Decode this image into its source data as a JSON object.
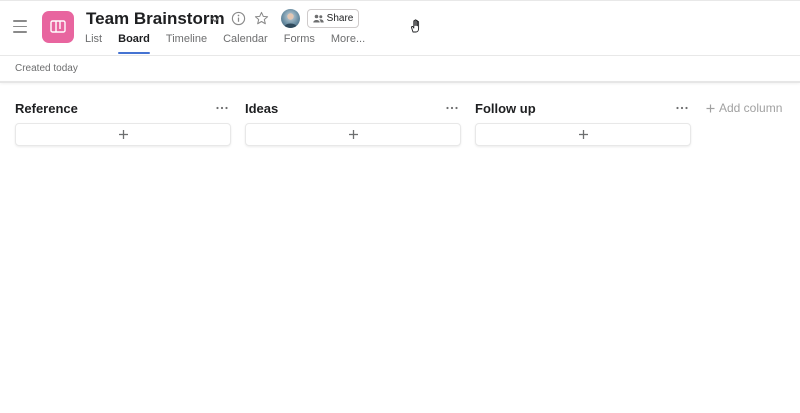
{
  "project": {
    "title": "Team Brainstorm",
    "icon": "board-icon",
    "icon_color": "#e8659f",
    "share_label": "Share"
  },
  "tabs": [
    {
      "label": "List",
      "active": false
    },
    {
      "label": "Board",
      "active": true
    },
    {
      "label": "Timeline",
      "active": false
    },
    {
      "label": "Calendar",
      "active": false
    },
    {
      "label": "Forms",
      "active": false
    },
    {
      "label": "More...",
      "active": false
    }
  ],
  "subheader": {
    "created": "Created today"
  },
  "board": {
    "columns": [
      {
        "title": "Reference"
      },
      {
        "title": "Ideas"
      },
      {
        "title": "Follow up"
      }
    ],
    "add_column_label": "Add column"
  },
  "colors": {
    "accent": "#4573d2",
    "text": "#1e1f21",
    "muted": "#6d6e6f"
  }
}
